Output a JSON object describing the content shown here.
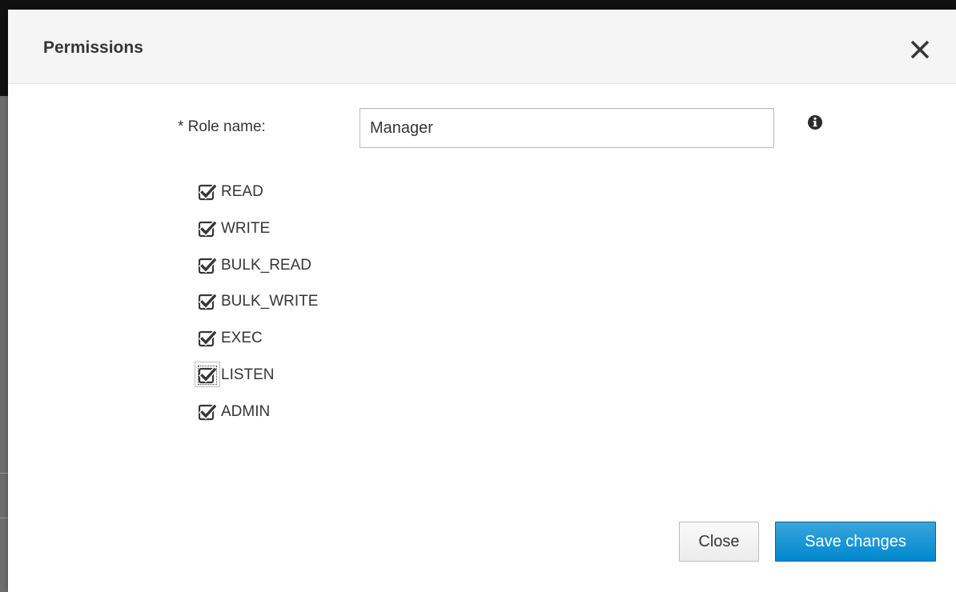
{
  "dialog": {
    "title": "Permissions",
    "close_icon": "close-icon"
  },
  "form": {
    "role_label": "* Role name:",
    "role_value": "Manager",
    "info_icon": "info-icon"
  },
  "permissions": [
    {
      "label": "READ",
      "checked": true
    },
    {
      "label": "WRITE",
      "checked": true
    },
    {
      "label": "BULK_READ",
      "checked": true
    },
    {
      "label": "BULK_WRITE",
      "checked": true
    },
    {
      "label": "EXEC",
      "checked": true
    },
    {
      "label": "LISTEN",
      "checked": true,
      "focused": true
    },
    {
      "label": "ADMIN",
      "checked": true
    }
  ],
  "footer": {
    "close_label": "Close",
    "save_label": "Save changes"
  },
  "colors": {
    "primary": "#0088ce",
    "header_bg": "#f5f5f5",
    "text": "#363636"
  }
}
